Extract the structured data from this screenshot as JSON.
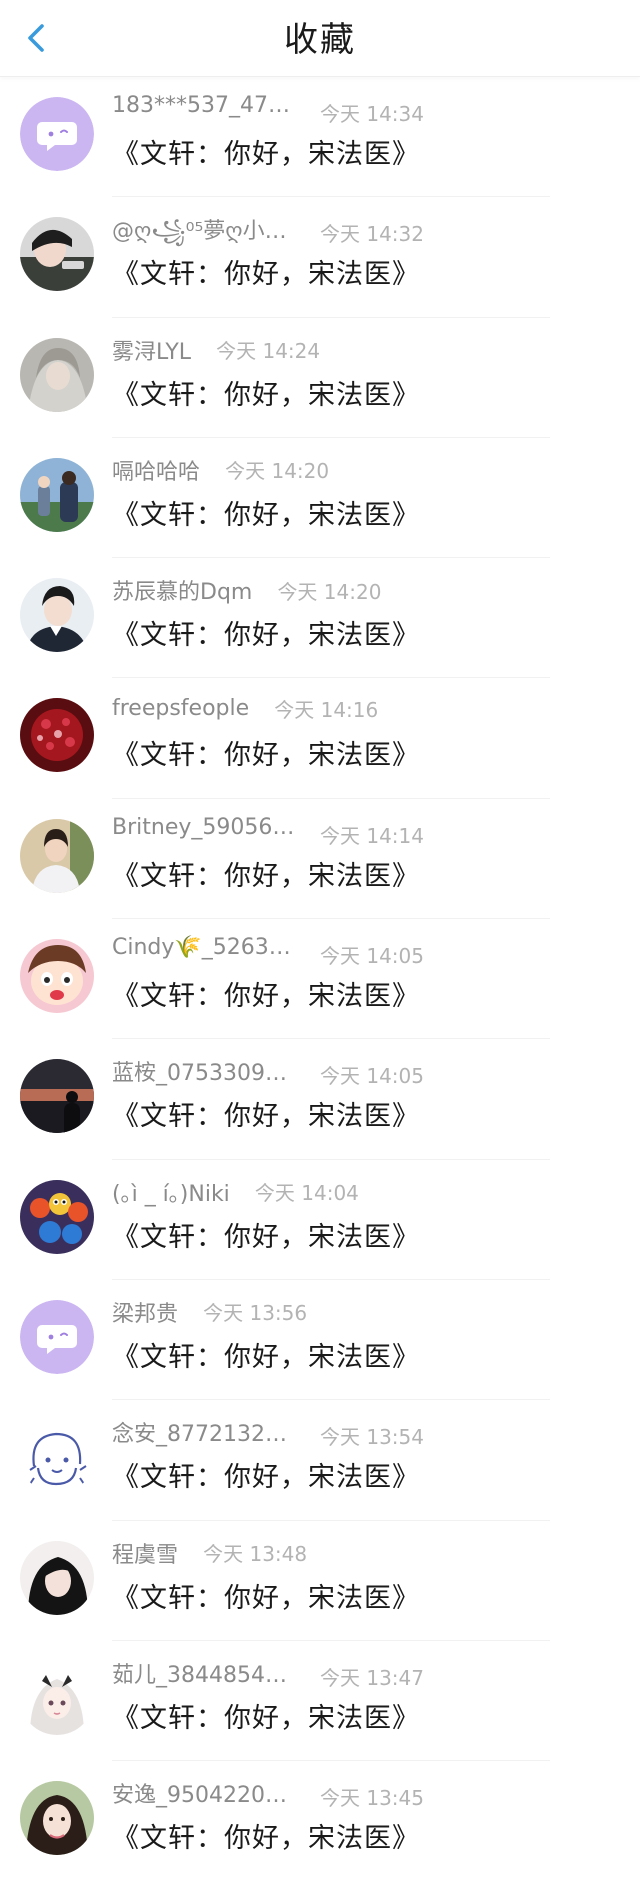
{
  "header": {
    "title": "收藏",
    "back_icon": "chevron-left-icon",
    "accent_color": "#3a9bdc"
  },
  "items": [
    {
      "name": "183***537_477…",
      "time": "今天 14:34",
      "message": "《文轩：你好，宋法医》",
      "avatar": "chat-bubble-avatar"
    },
    {
      "name": "@ღ꧁⁰⁵夢ღ小ღ…",
      "time": "今天 14:32",
      "message": "《文轩：你好，宋法医》",
      "avatar": "photo-avatar"
    },
    {
      "name": "雾浔LYL",
      "time": "今天 14:24",
      "message": "《文轩：你好，宋法医》",
      "avatar": "photo-avatar"
    },
    {
      "name": "嗝哈哈哈",
      "time": "今天 14:20",
      "message": "《文轩：你好，宋法医》",
      "avatar": "photo-avatar"
    },
    {
      "name": "苏辰慕的Dqm",
      "time": "今天 14:20",
      "message": "《文轩：你好，宋法医》",
      "avatar": "photo-avatar"
    },
    {
      "name": "freepsfeople",
      "time": "今天 14:16",
      "message": "《文轩：你好，宋法医》",
      "avatar": "photo-avatar"
    },
    {
      "name": "Britney_59056…",
      "time": "今天 14:14",
      "message": "《文轩：你好，宋法医》",
      "avatar": "photo-avatar"
    },
    {
      "name": "Cindy🌾_5263…",
      "time": "今天 14:05",
      "message": "《文轩：你好，宋法医》",
      "avatar": "cartoon-avatar"
    },
    {
      "name": "蓝桉_0753309…",
      "time": "今天 14:05",
      "message": "《文轩：你好，宋法医》",
      "avatar": "photo-avatar"
    },
    {
      "name": "(｡ì _ í｡)Niki",
      "time": "今天 14:04",
      "message": "《文轩：你好，宋法医》",
      "avatar": "cartoon-avatar"
    },
    {
      "name": "梁邦贵",
      "time": "今天 13:56",
      "message": "《文轩：你好，宋法医》",
      "avatar": "chat-bubble-avatar"
    },
    {
      "name": "念安_8772132…",
      "time": "今天 13:54",
      "message": "《文轩：你好，宋法医》",
      "avatar": "sketch-avatar"
    },
    {
      "name": "程虞雪",
      "time": "今天 13:48",
      "message": "《文轩：你好，宋法医》",
      "avatar": "photo-avatar"
    },
    {
      "name": "茹儿_3844854…",
      "time": "今天 13:47",
      "message": "《文轩：你好，宋法医》",
      "avatar": "anime-avatar"
    },
    {
      "name": "安逸_9504220…",
      "time": "今天 13:45",
      "message": "《文轩：你好，宋法医》",
      "avatar": "photo-avatar"
    }
  ]
}
